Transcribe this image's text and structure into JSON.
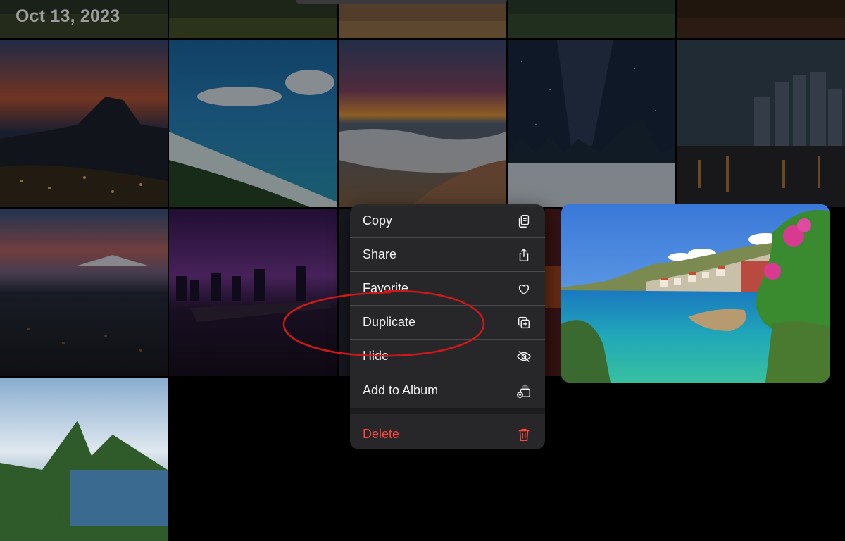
{
  "header": {
    "date": "Oct 13, 2023"
  },
  "context_menu": {
    "items": [
      {
        "label": "Copy",
        "icon": "copy-icon"
      },
      {
        "label": "Share",
        "icon": "share-icon"
      },
      {
        "label": "Favorite",
        "icon": "heart-icon"
      },
      {
        "label": "Duplicate",
        "icon": "duplicate-icon"
      },
      {
        "label": "Hide",
        "icon": "eye-slash-icon"
      },
      {
        "label": "Add to Album",
        "icon": "add-to-album-icon"
      }
    ],
    "delete": {
      "label": "Delete",
      "icon": "trash-icon"
    }
  },
  "colors": {
    "menu_bg": "#28282a",
    "delete": "#ff453a",
    "annotation": "#d01818",
    "background": "#000000"
  }
}
